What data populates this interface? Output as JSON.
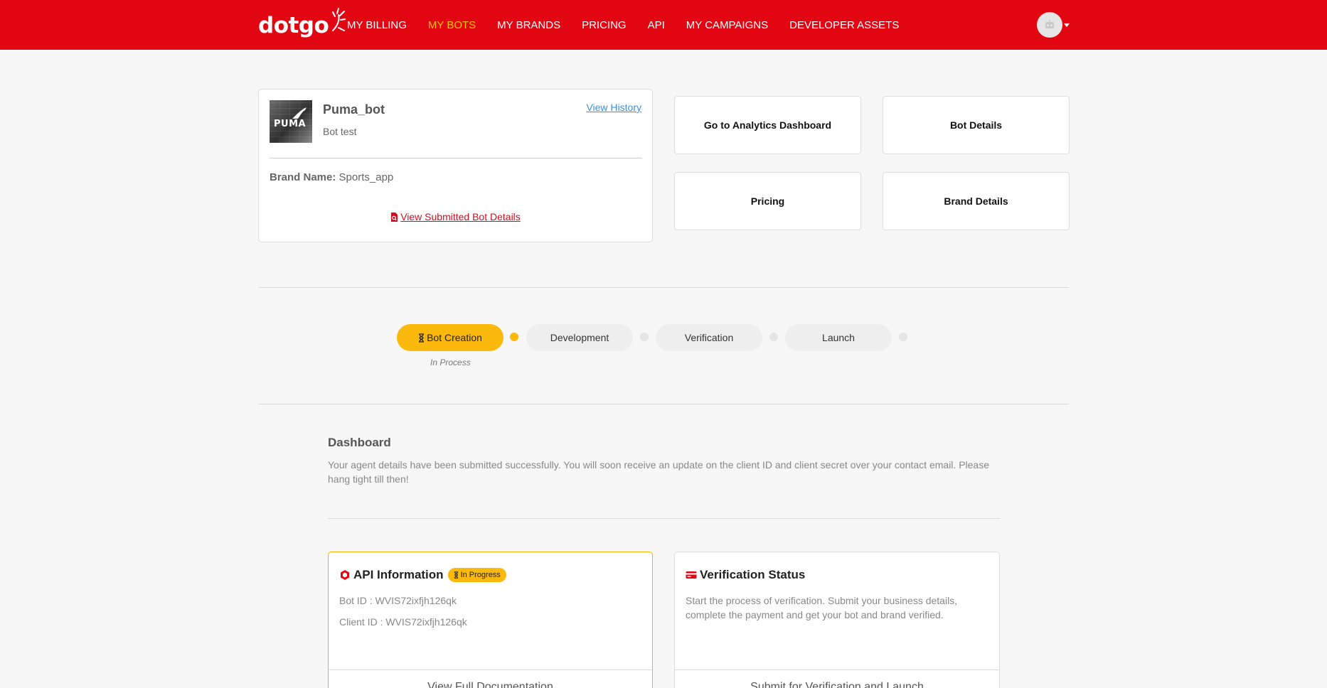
{
  "nav": {
    "logo": "dotgo",
    "items": [
      {
        "label": "MY BILLING",
        "active": false
      },
      {
        "label": "MY BOTS",
        "active": true
      },
      {
        "label": "MY BRANDS",
        "active": false
      },
      {
        "label": "PRICING",
        "active": false
      },
      {
        "label": "API",
        "active": false
      },
      {
        "label": "MY CAMPAIGNS",
        "active": false
      },
      {
        "label": "DEVELOPER ASSETS",
        "active": false
      }
    ],
    "avatar_icon": "robot-icon"
  },
  "bot": {
    "thumb_text": "PUMA",
    "name": "Puma_bot",
    "description": "Bot test",
    "view_history": "View History",
    "brand_label": "Brand Name:",
    "brand_value": "Sports_app",
    "submitted_link": "View Submitted Bot Details"
  },
  "quick_actions": {
    "analytics": "Go to Analytics Dashboard",
    "bot_details": "Bot Details",
    "pricing": "Pricing",
    "brand_details": "Brand Details"
  },
  "stepper": {
    "steps": [
      {
        "label": "Bot Creation",
        "active": true,
        "status": "In Process"
      },
      {
        "label": "Development",
        "active": false
      },
      {
        "label": "Verification",
        "active": false
      },
      {
        "label": "Launch",
        "active": false
      }
    ]
  },
  "dashboard": {
    "title": "Dashboard",
    "message": "Your agent details have been submitted successfully. You will soon receive an update on the client ID and client secret over your contact email. Please hang tight till then!"
  },
  "api_panel": {
    "title": "API Information",
    "badge": "In Progress",
    "bot_id": "Bot ID : WVIS72ixfjh126qk",
    "client_id": "Client ID : WVIS72ixfjh126qk",
    "footer": "View Full Documentation"
  },
  "verification_panel": {
    "title": "Verification Status",
    "description": "Start the process of verification. Submit your business details, complete the payment and get your bot and brand verified.",
    "footer": "Submit for Verification and Launch"
  },
  "colors": {
    "brand_red": "#e20613",
    "accent_yellow": "#fbb90e",
    "link_blue": "#3f8fdc"
  }
}
